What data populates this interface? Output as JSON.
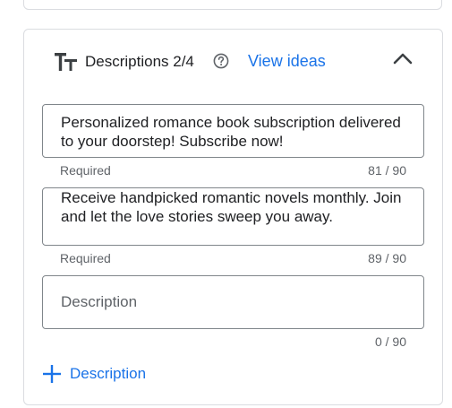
{
  "section": {
    "title": "Descriptions 2/4",
    "view_ideas_label": "View ideas"
  },
  "descriptions": [
    {
      "value": "Personalized romance book subscription delivered to your doorstep! Subscribe now!",
      "helper": "Required",
      "counter": "81 / 90"
    },
    {
      "value": "Receive handpicked romantic novels monthly. Join and let the love stories sweep you away.",
      "helper": "Required",
      "counter": "89 / 90"
    },
    {
      "value": "",
      "placeholder": "Description",
      "helper": "",
      "counter": "0 / 90"
    }
  ],
  "add_button_label": "Description",
  "colors": {
    "accent": "#1a73e8",
    "text": "#202124",
    "secondary_text": "#5f6368",
    "border": "#dadce0"
  },
  "icons": [
    "text-format-icon",
    "help-icon",
    "chevron-up-icon",
    "plus-icon"
  ]
}
